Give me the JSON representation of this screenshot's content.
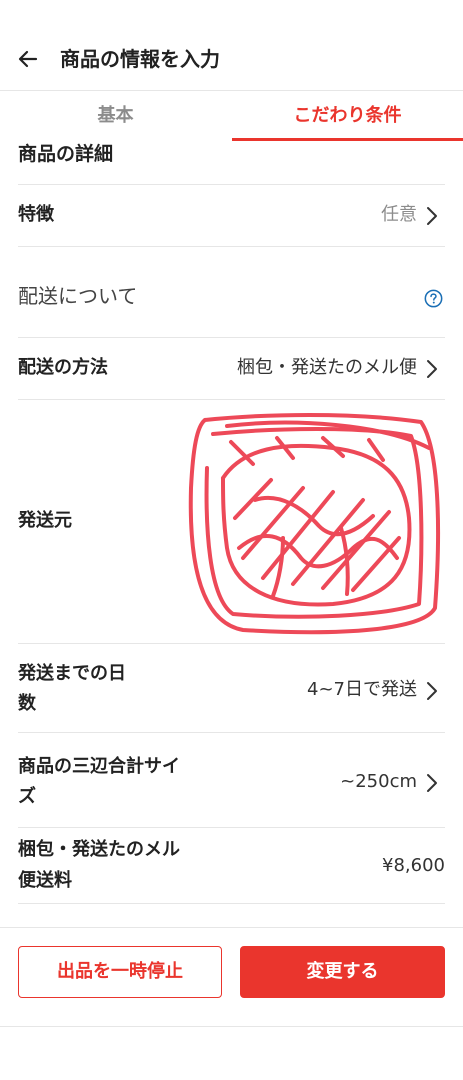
{
  "header": {
    "title": "商品の情報を入力",
    "back_icon": "arrow-left-icon"
  },
  "tabs": [
    {
      "label": "基本",
      "active": false
    },
    {
      "label": "こだわり条件",
      "active": true
    }
  ],
  "colors": {
    "accent": "#ea352d",
    "muted": "#8c8c8c",
    "help": "#1b6fb5"
  },
  "details": {
    "heading": "商品の詳細",
    "features_label": "特徴",
    "features_value": "任意"
  },
  "shipping": {
    "section_title": "配送について",
    "method_label": "配送の方法",
    "method_value": "梱包・発送たのメル便",
    "origin_label": "発送元",
    "days_label_line1": "発送までの日",
    "days_label_line2": "数",
    "days_value": "4~7日で発送",
    "size_label_line1": "商品の三辺合計サイ",
    "size_label_line2": "ズ",
    "size_value": "~250cm",
    "fee_label_line1": "梱包・発送たのメル",
    "fee_label_line2": "便送料",
    "fee_value": "¥8,600"
  },
  "buttons": {
    "pause": "出品を一時停止",
    "change": "変更する"
  }
}
